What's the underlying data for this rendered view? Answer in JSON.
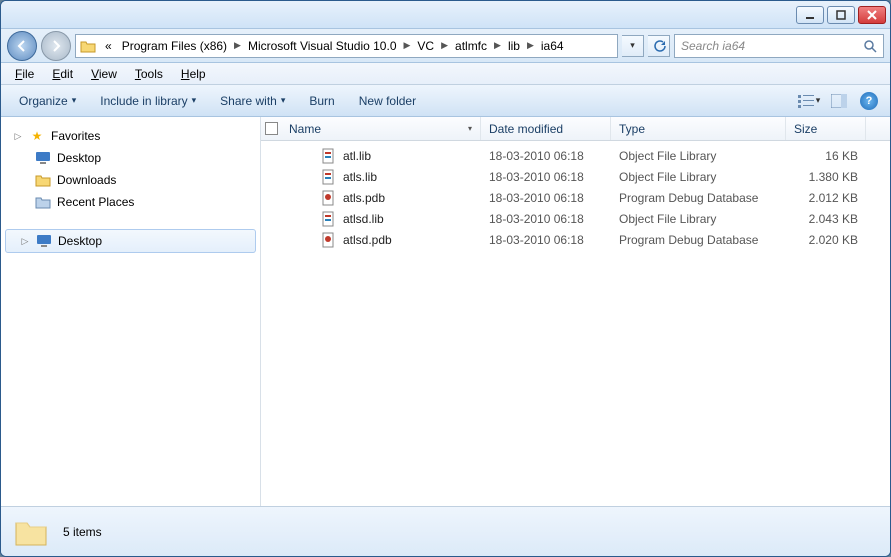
{
  "breadcrumbs": {
    "prefix": "«",
    "items": [
      "Program Files (x86)",
      "Microsoft Visual Studio 10.0",
      "VC",
      "atlmfc",
      "lib",
      "ia64"
    ]
  },
  "search": {
    "placeholder": "Search ia64"
  },
  "menu": {
    "file": "File",
    "edit": "Edit",
    "view": "View",
    "tools": "Tools",
    "help": "Help"
  },
  "toolbar": {
    "organize": "Organize",
    "include": "Include in library",
    "share": "Share with",
    "burn": "Burn",
    "newfolder": "New folder"
  },
  "sidebar": {
    "favorites": {
      "label": "Favorites",
      "items": [
        {
          "label": "Desktop",
          "icon": "desktop"
        },
        {
          "label": "Downloads",
          "icon": "folder"
        },
        {
          "label": "Recent Places",
          "icon": "recent"
        }
      ]
    },
    "desktop": {
      "label": "Desktop",
      "icon": "desktop"
    }
  },
  "columns": {
    "name": "Name",
    "date": "Date modified",
    "type": "Type",
    "size": "Size"
  },
  "files": [
    {
      "name": "atl.lib",
      "date": "18-03-2010 06:18",
      "type": "Object File Library",
      "size": "16 KB",
      "icon": "lib"
    },
    {
      "name": "atls.lib",
      "date": "18-03-2010 06:18",
      "type": "Object File Library",
      "size": "1.380 KB",
      "icon": "lib"
    },
    {
      "name": "atls.pdb",
      "date": "18-03-2010 06:18",
      "type": "Program Debug Database",
      "size": "2.012 KB",
      "icon": "pdb"
    },
    {
      "name": "atlsd.lib",
      "date": "18-03-2010 06:18",
      "type": "Object File Library",
      "size": "2.043 KB",
      "icon": "lib"
    },
    {
      "name": "atlsd.pdb",
      "date": "18-03-2010 06:18",
      "type": "Program Debug Database",
      "size": "2.020 KB",
      "icon": "pdb"
    }
  ],
  "status": {
    "count": "5 items"
  }
}
